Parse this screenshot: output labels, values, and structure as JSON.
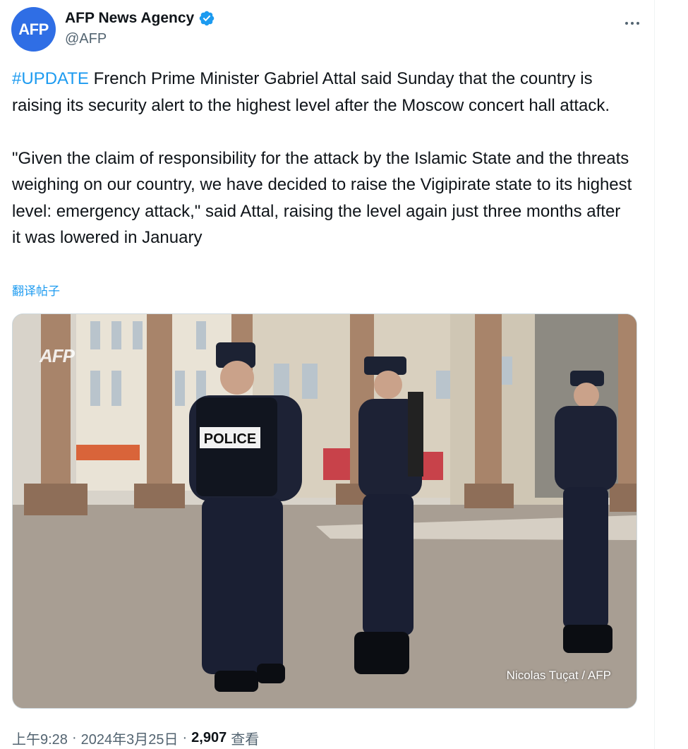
{
  "author": {
    "avatar_text": "AFP",
    "display_name": "AFP News Agency",
    "handle": "@AFP",
    "verified": true,
    "avatar_color": "#2f6ee5"
  },
  "tweet": {
    "hashtag": "#UPDATE",
    "body": " French Prime Minister Gabriel Attal said Sunday that the country is raising its security alert to the highest level after the Moscow concert hall attack.\n\n\"Given the claim of responsibility for the attack by the Islamic State and the threats weighing on our country, we have decided to raise the Vigipirate state to its highest level: emergency attack,\" said Attal, raising the level again just three months after it was lowered in January",
    "translate_label": "翻译帖子"
  },
  "media": {
    "watermark": "AFP",
    "photo_credit": "Nicolas Tuçat / AFP",
    "vest_label": "POLICE"
  },
  "meta": {
    "time": "上午9:28",
    "date": "2024年3月25日",
    "separator": "·",
    "views_count": "2,907",
    "views_label": "查看"
  },
  "colors": {
    "link": "#1d9bf0",
    "secondary_text": "#536471",
    "verified_badge": "#1d9bf0"
  },
  "icons": {
    "verified": "verified-badge-icon",
    "more": "more-options-icon"
  }
}
